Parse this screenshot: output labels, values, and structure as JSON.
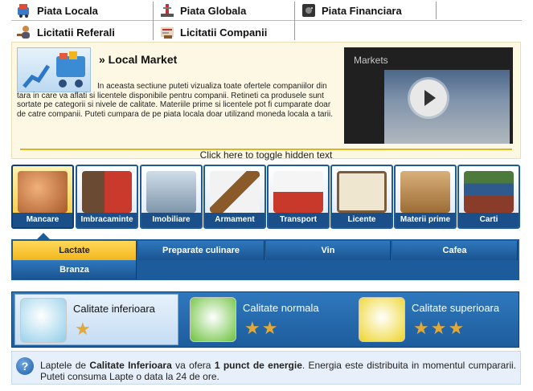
{
  "nav": {
    "items": [
      {
        "label": "Piata Locala",
        "icon": "market-cart-icon"
      },
      {
        "label": "Piata Globala",
        "icon": "oil-rig-icon"
      },
      {
        "label": "Piata Financiara",
        "icon": "safe-icon"
      },
      {
        "label": "Licitatii Referali",
        "icon": "auction-user-icon"
      },
      {
        "label": "Licitatii Companii",
        "icon": "auction-company-icon"
      }
    ]
  },
  "info": {
    "title": "» Local Market",
    "description": "In aceasta sectiune puteti vizualiza toate ofertele companiilor din tara in care va aflati si licentele disponibile pentru companii. Retineti ca produsele sunt sortate pe categorii si nivele de calitate. Materiile prime si licentele pot fi cumparate doar de catre companii. Puteti cumpara de pe piata locala doar utilizand moneda locala a tarii.",
    "video_title": "Markets"
  },
  "toggle_label": "Click here to toggle hidden text",
  "categories": [
    {
      "label": "Mancare",
      "color": "#c97a3c"
    },
    {
      "label": "Imbracaminte",
      "color": "#8a5a3a"
    },
    {
      "label": "Imobiliare",
      "color": "#8fa7c4"
    },
    {
      "label": "Armament",
      "color": "#7a5b3c"
    },
    {
      "label": "Transport",
      "color": "#c94a3c"
    },
    {
      "label": "Licente",
      "color": "#d8c9a6"
    },
    {
      "label": "Materii prime",
      "color": "#b58a52"
    },
    {
      "label": "Carti",
      "color": "#5b7a4a"
    }
  ],
  "active_category": "Mancare",
  "subcategories": [
    {
      "label": "Lactate"
    },
    {
      "label": "Preparate culinare"
    },
    {
      "label": "Vin"
    },
    {
      "label": "Cafea"
    },
    {
      "label": "Branza"
    }
  ],
  "active_subcategory": "Lactate",
  "qualities": [
    {
      "label": "Calitate inferioara",
      "stars": 1,
      "star_text": "★",
      "art_color": "#bfe4f7"
    },
    {
      "label": "Calitate normala",
      "stars": 2,
      "star_text": "★★",
      "art_color": "#7fd04a"
    },
    {
      "label": "Calitate superioara",
      "stars": 3,
      "star_text": "★★★",
      "art_color": "#f3e23a"
    }
  ],
  "active_quality": "Calitate inferioara",
  "footer": {
    "t1": "Laptele de ",
    "t2": "Calitate Inferioara",
    "t3": " va ofera ",
    "t4": "1 punct de energie",
    "t5": ". Energia este distribuita in momentul cumpararii. Puteti consuma Lapte o data la 24 de ore."
  }
}
